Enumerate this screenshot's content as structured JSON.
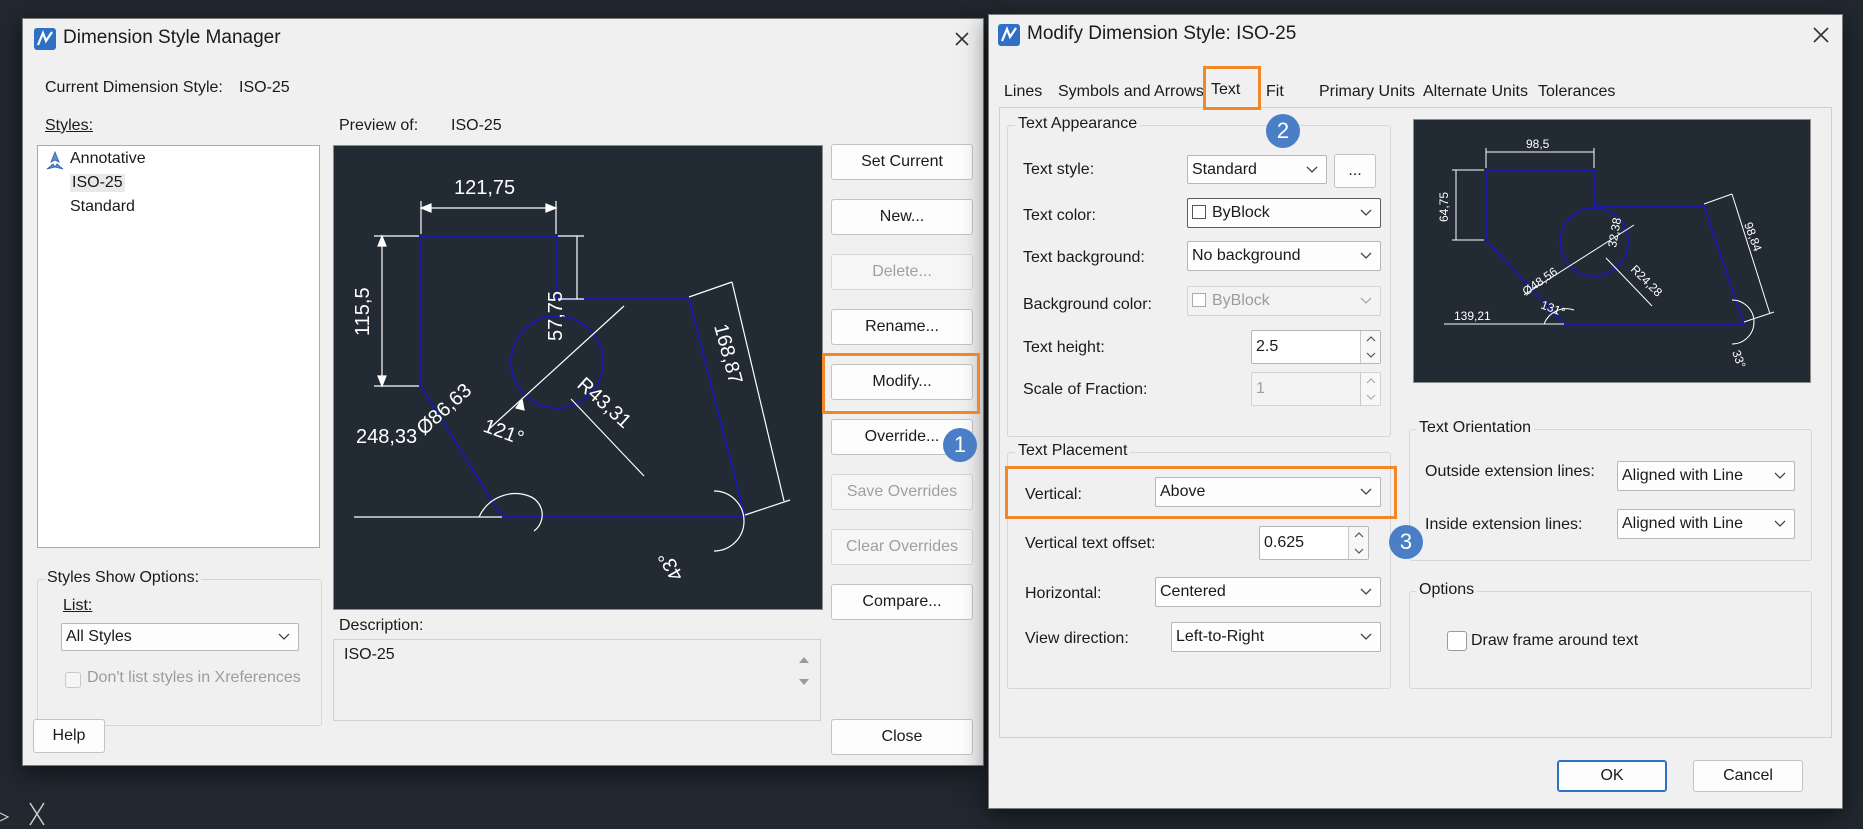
{
  "colors": {
    "accent": "#f0882a",
    "badge": "#4a7fc8",
    "preview_bg": "#222a33",
    "geometry": "#1a1aa8",
    "dims": "#ffffff"
  },
  "manager": {
    "title": "Dimension Style Manager",
    "current_label": "Current Dimension Style:",
    "current_value": "ISO-25",
    "styles_label": "Styles:",
    "styles": [
      {
        "name": "Annotative",
        "icon": "annotative-icon"
      },
      {
        "name": "ISO-25"
      },
      {
        "name": "Standard"
      }
    ],
    "preview_label": "Preview of:",
    "preview_value": "ISO-25",
    "buttons": {
      "set_current": "Set Current",
      "new": "New...",
      "delete": "Delete...",
      "rename": "Rename...",
      "modify": "Modify...",
      "override": "Override...",
      "save_overrides": "Save Overrides",
      "clear_overrides": "Clear Overrides",
      "compare": "Compare...",
      "close": "Close",
      "help": "Help"
    },
    "show_options_label": "Styles Show Options:",
    "list_label": "List:",
    "list_value": "All Styles",
    "xref_checkbox": "Don't list styles in Xreferences",
    "description_label": "Description:",
    "description_value": "ISO-25",
    "preview_dims": {
      "top": "121,75",
      "left": "115,5",
      "vertical": "57,75",
      "slant": "168,87",
      "diameter": "Ø86,63",
      "radius": "R43,31",
      "angle": "121°",
      "baseline": "248,33",
      "angle2": "43°"
    }
  },
  "modify": {
    "title": "Modify Dimension Style: ISO-25",
    "tabs": [
      "Lines",
      "Symbols and Arrows",
      "Text",
      "Fit",
      "Primary Units",
      "Alternate Units",
      "Tolerances"
    ],
    "active_tab": "Text",
    "appearance": {
      "title": "Text Appearance",
      "text_style_label": "Text style:",
      "text_style_value": "Standard",
      "ellipsis": "...",
      "text_color_label": "Text color:",
      "text_color_value": "ByBlock",
      "text_bg_label": "Text background:",
      "text_bg_value": "No background",
      "bg_color_label": "Background color:",
      "bg_color_value": "ByBlock",
      "text_height_label": "Text height:",
      "text_height_value": "2.5",
      "scale_label": "Scale of Fraction:",
      "scale_value": "1"
    },
    "placement": {
      "title": "Text Placement",
      "vertical_label": "Vertical:",
      "vertical_value": "Above",
      "offset_label": "Vertical text offset:",
      "offset_value": "0.625",
      "horizontal_label": "Horizontal:",
      "horizontal_value": "Centered",
      "view_label": "View direction:",
      "view_value": "Left-to-Right"
    },
    "orientation": {
      "title": "Text Orientation",
      "outside_label": "Outside extension lines:",
      "outside_value": "Aligned with Line",
      "inside_label": "Inside extension lines:",
      "inside_value": "Aligned with Line"
    },
    "options": {
      "title": "Options",
      "frame_label": "Draw frame around text"
    },
    "preview_dims": {
      "top": "98,5",
      "left": "64,75",
      "vertical": "32,38",
      "slant": "98,84",
      "diameter": "Ø48,56",
      "radius": "R24,28",
      "angle": "131°",
      "baseline": "139,21",
      "angle2": "33°"
    },
    "ok": "OK",
    "cancel": "Cancel"
  },
  "badges": [
    "1",
    "2",
    "3"
  ]
}
